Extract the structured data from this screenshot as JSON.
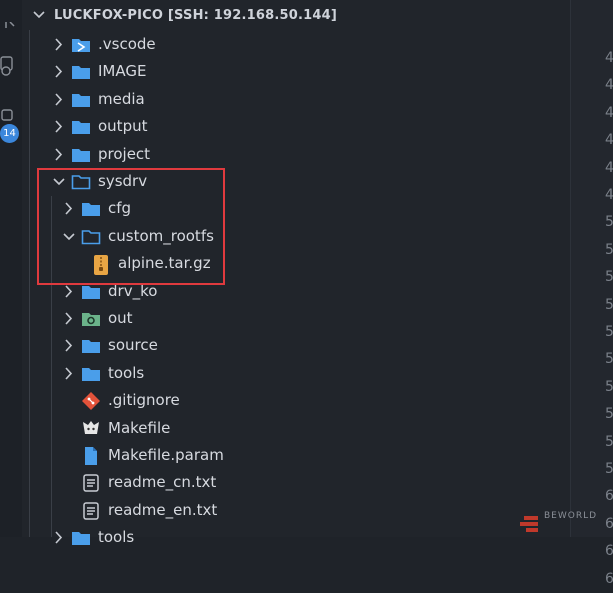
{
  "activity_bar": {
    "badge_count": "14"
  },
  "explorer": {
    "title": "LUCKFOX-PICO [SSH: 192.168.50.144]",
    "items": [
      {
        "label": ".vscode",
        "type": "vscode-folder",
        "expanded": false
      },
      {
        "label": "IMAGE",
        "type": "folder",
        "expanded": false
      },
      {
        "label": "media",
        "type": "folder",
        "expanded": false
      },
      {
        "label": "output",
        "type": "folder",
        "expanded": false
      },
      {
        "label": "project",
        "type": "folder",
        "expanded": false
      },
      {
        "label": "sysdrv",
        "type": "folder",
        "expanded": true
      },
      {
        "label": "cfg",
        "type": "folder",
        "expanded": false
      },
      {
        "label": "custom_rootfs",
        "type": "folder",
        "expanded": true
      },
      {
        "label": "alpine.tar.gz",
        "type": "archive-file"
      },
      {
        "label": "drv_ko",
        "type": "folder",
        "expanded": false
      },
      {
        "label": "out",
        "type": "gear-folder",
        "expanded": false
      },
      {
        "label": "source",
        "type": "folder",
        "expanded": false
      },
      {
        "label": "tools",
        "type": "folder",
        "expanded": false
      },
      {
        "label": ".gitignore",
        "type": "git-file"
      },
      {
        "label": "Makefile",
        "type": "makefile-file"
      },
      {
        "label": "Makefile.param",
        "type": "file"
      },
      {
        "label": "readme_cn.txt",
        "type": "text-file"
      },
      {
        "label": "readme_en.txt",
        "type": "text-file"
      },
      {
        "label": "tools",
        "type": "folder",
        "expanded": false
      }
    ]
  },
  "editor_gutter": {
    "line_numbers": [
      "4",
      "4",
      "4",
      "4",
      "4",
      "4",
      "5",
      "5",
      "5",
      "5",
      "5",
      "5",
      "5",
      "5",
      "5",
      "5",
      "6",
      "6",
      "6",
      "6"
    ]
  },
  "watermark": {
    "text": "BEWORLD"
  },
  "colors": {
    "highlight_border": "#e03a3e",
    "folder_blue": "#4a9eea",
    "badge_blue": "#3b87dc",
    "archive_orange": "#e8a544",
    "git_red": "#e2523a",
    "gear_green": "#6bb38a"
  }
}
